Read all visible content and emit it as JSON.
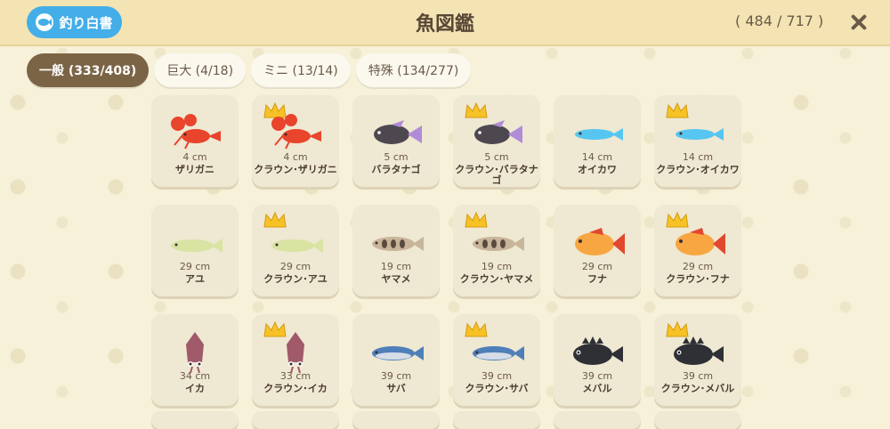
{
  "header": {
    "book_button_label": "釣り白書",
    "title": "魚図鑑",
    "count": "( 484 / 717 )"
  },
  "tabs": [
    {
      "label": "一般 (333/408)",
      "active": true
    },
    {
      "label": "巨大 (4/18)",
      "active": false
    },
    {
      "label": "ミニ (13/14)",
      "active": false
    },
    {
      "label": "特殊 (134/277)",
      "active": false
    }
  ],
  "fish": [
    {
      "name": "ザリガニ",
      "size": "4 cm",
      "crown": false,
      "kind": "crayfish",
      "color": "#e8452c"
    },
    {
      "name": "クラウン･ザリガニ",
      "size": "4 cm",
      "crown": true,
      "kind": "crayfish",
      "color": "#e8452c"
    },
    {
      "name": "バラタナゴ",
      "size": "5 cm",
      "crown": false,
      "kind": "bitterling",
      "color": "#4d4750"
    },
    {
      "name": "クラウン･バラタナゴ",
      "size": "5 cm",
      "crown": true,
      "kind": "bitterling",
      "color": "#4d4750"
    },
    {
      "name": "オイカワ",
      "size": "14 cm",
      "crown": false,
      "kind": "minnow",
      "color": "#56c6f0"
    },
    {
      "name": "クラウン･オイカワ",
      "size": "14 cm",
      "crown": true,
      "kind": "minnow",
      "color": "#56c6f0"
    },
    {
      "name": "アユ",
      "size": "29 cm",
      "crown": false,
      "kind": "ayu",
      "color": "#d9e3a2"
    },
    {
      "name": "クラウン･アユ",
      "size": "29 cm",
      "crown": true,
      "kind": "ayu",
      "color": "#d9e3a2"
    },
    {
      "name": "ヤマメ",
      "size": "19 cm",
      "crown": false,
      "kind": "trout",
      "color": "#c9b59a"
    },
    {
      "name": "クラウン･ヤマメ",
      "size": "19 cm",
      "crown": true,
      "kind": "trout",
      "color": "#c9b59a"
    },
    {
      "name": "フナ",
      "size": "29 cm",
      "crown": false,
      "kind": "carp",
      "color": "#f7a641"
    },
    {
      "name": "クラウン･フナ",
      "size": "29 cm",
      "crown": true,
      "kind": "carp",
      "color": "#f7a641"
    },
    {
      "name": "イカ",
      "size": "34 cm",
      "crown": false,
      "kind": "squid",
      "color": "#a05a6a"
    },
    {
      "name": "クラウン･イカ",
      "size": "33 cm",
      "crown": true,
      "kind": "squid",
      "color": "#a05a6a"
    },
    {
      "name": "サバ",
      "size": "39 cm",
      "crown": false,
      "kind": "mackerel",
      "color": "#4f7fb8"
    },
    {
      "name": "クラウン･サバ",
      "size": "39 cm",
      "crown": true,
      "kind": "mackerel",
      "color": "#4f7fb8"
    },
    {
      "name": "メバル",
      "size": "39 cm",
      "crown": false,
      "kind": "rockfish",
      "color": "#2f2f36"
    },
    {
      "name": "クラウン･メバル",
      "size": "39 cm",
      "crown": true,
      "kind": "rockfish",
      "color": "#2f2f36"
    }
  ]
}
